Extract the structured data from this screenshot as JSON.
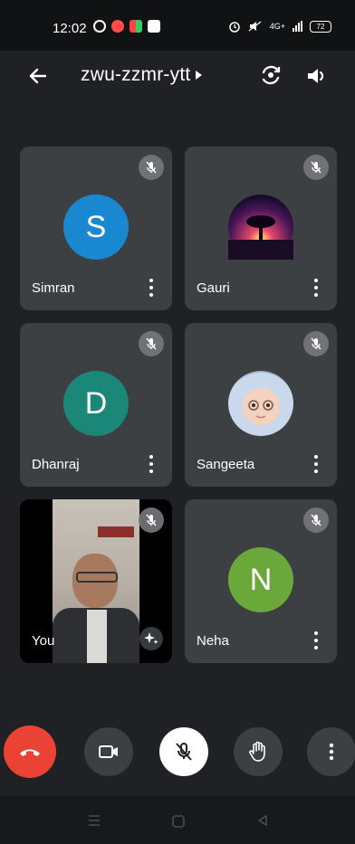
{
  "status_bar": {
    "time": "12:02",
    "network_label": "4G+",
    "battery": "72"
  },
  "header": {
    "meeting_code": "zwu-zzmr-ytt"
  },
  "participants": [
    {
      "name": "Simran",
      "initial": "S",
      "avatar_color": "#1a88d0",
      "muted": true
    },
    {
      "name": "Gauri",
      "initial": "",
      "avatar_type": "photo-sunset",
      "muted": true
    },
    {
      "name": "Dhanraj",
      "initial": "D",
      "avatar_color": "#1b8779",
      "muted": true
    },
    {
      "name": "Sangeeta",
      "initial": "",
      "avatar_type": "photo-baby",
      "muted": true
    },
    {
      "name": "You",
      "initial": "",
      "avatar_type": "camera-video",
      "muted": true
    },
    {
      "name": "Neha",
      "initial": "N",
      "avatar_color": "#6aa83a",
      "muted": true
    }
  ],
  "controls": {
    "hangup_color": "#ea4335",
    "mic_muted": true
  },
  "icons": {
    "back": "arrow-left-icon",
    "flip": "camera-flip-icon",
    "speaker": "speaker-icon",
    "mute": "mic-off-icon",
    "more": "more-vert-icon",
    "effects": "sparkle-icon",
    "hangup": "phone-hangup-icon",
    "camera": "video-camera-icon",
    "hand": "raise-hand-icon",
    "overflow": "more-vert-icon"
  }
}
